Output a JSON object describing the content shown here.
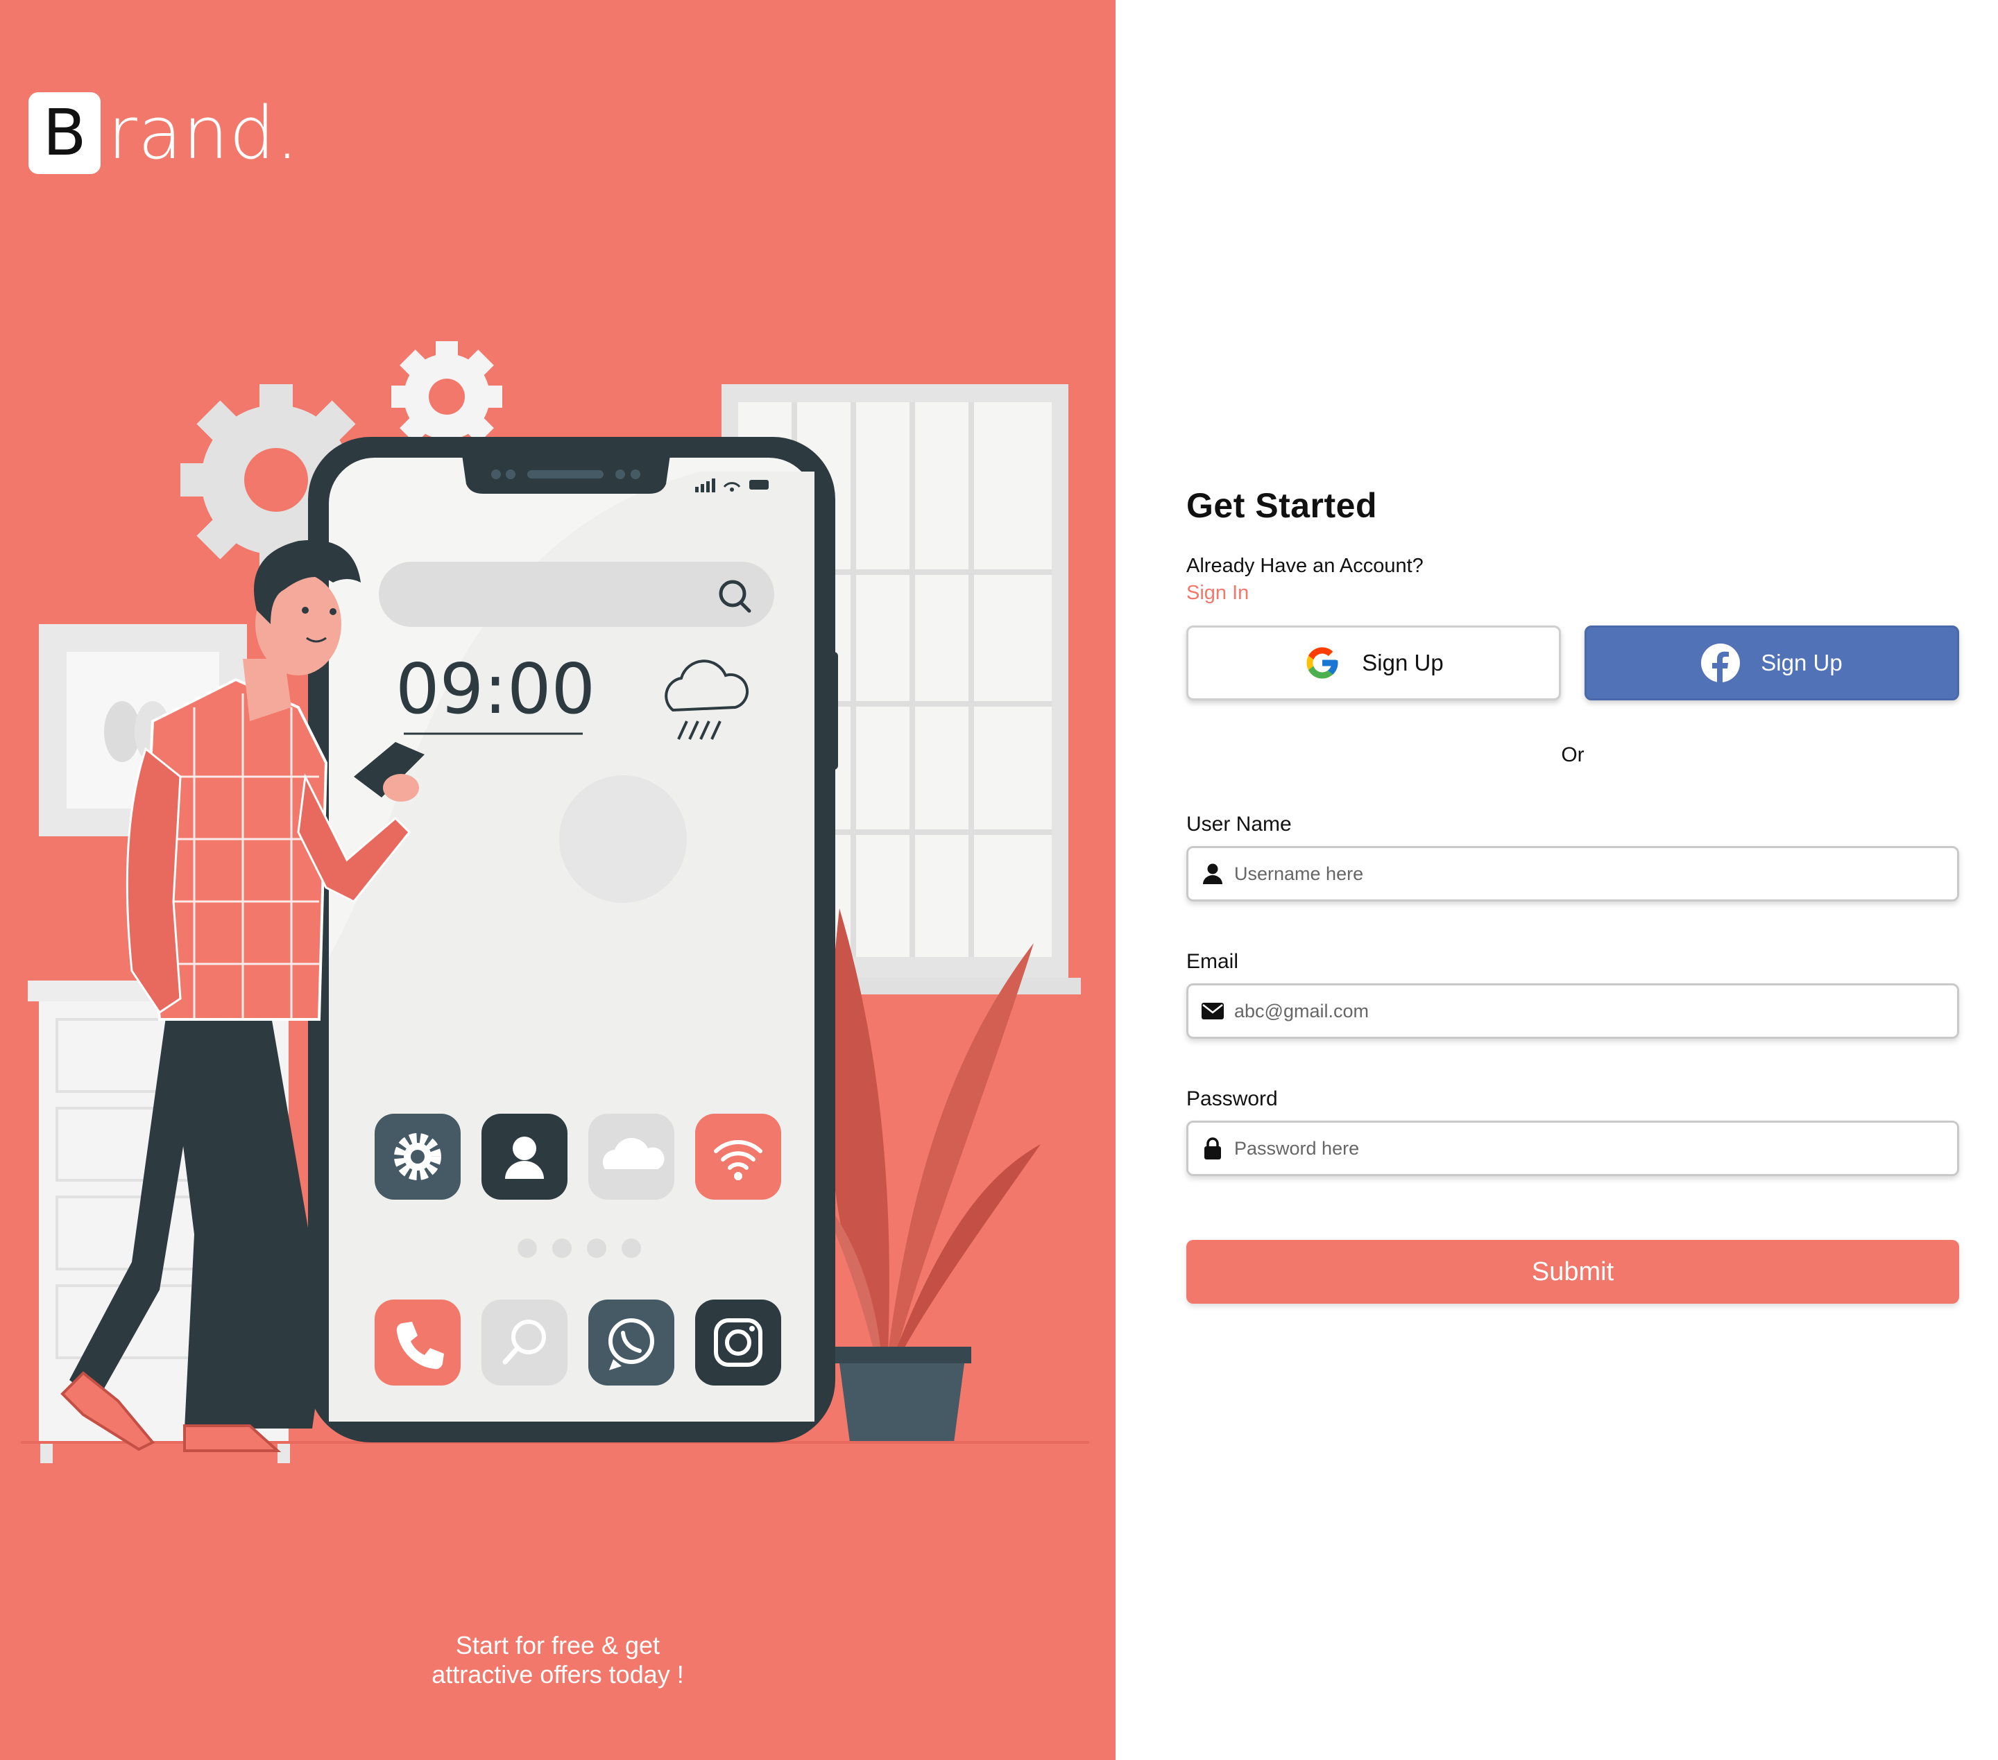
{
  "brand": {
    "letter": "B",
    "rest": "rand."
  },
  "illustration": {
    "clock": "09:00",
    "apps_row1": [
      "gear-icon",
      "user-icon",
      "cloud-icon",
      "wifi-icon"
    ],
    "apps_row2": [
      "phone-icon",
      "search-icon",
      "whatsapp-icon",
      "instagram-icon"
    ]
  },
  "tagline": {
    "line1": "Start for free & get",
    "line2": "attractive offers today !"
  },
  "form": {
    "title": "Get Started",
    "already": "Already Have an Account?",
    "signin": "Sign In",
    "google_label": "Sign Up",
    "facebook_label": "Sign Up",
    "or": "Or",
    "username": {
      "label": "User Name",
      "placeholder": "Username here"
    },
    "email": {
      "label": "Email",
      "placeholder": "abc@gmail.com"
    },
    "password": {
      "label": "Password",
      "placeholder": "Password here"
    },
    "submit": "Submit"
  },
  "colors": {
    "accent": "#f1786b",
    "facebook": "#5272b8",
    "dark": "#2d3b40",
    "slate": "#455a64"
  }
}
